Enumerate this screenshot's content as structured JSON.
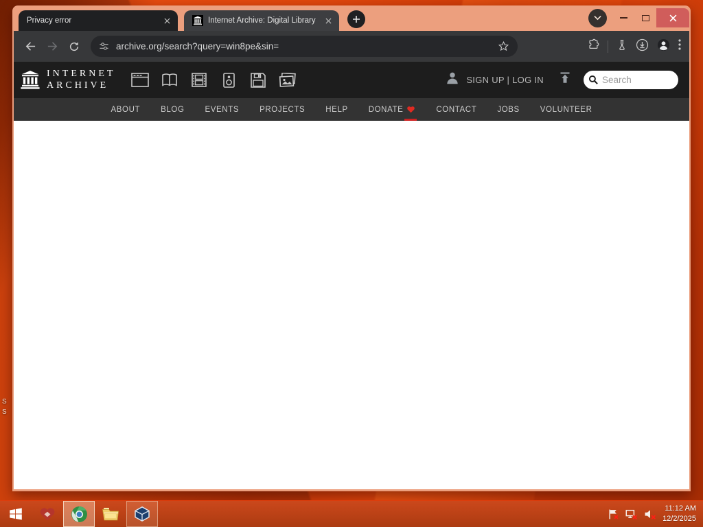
{
  "window": {
    "tabs": [
      {
        "title": "Privacy error",
        "active": false
      },
      {
        "title": "Internet Archive: Digital Library",
        "active": true
      }
    ],
    "url": "archive.org/search?query=win8pe&sin="
  },
  "ia": {
    "brand_line1": "INTERNET",
    "brand_line2": "ARCHIVE",
    "media_types": [
      "web",
      "texts",
      "video",
      "audio",
      "software",
      "images"
    ],
    "auth": "SIGN UP | LOG IN",
    "search_placeholder": "Search",
    "nav": [
      "ABOUT",
      "BLOG",
      "EVENTS",
      "PROJECTS",
      "HELP",
      "DONATE",
      "CONTACT",
      "JOBS",
      "VOLUNTEER"
    ]
  },
  "taskbar": {
    "time": "11:12 AM",
    "date": "12/2/2025"
  },
  "desktop": {
    "fragment1": "S",
    "fragment2": "S"
  },
  "colors": {
    "frame_salmon": "#ec9f7e",
    "desktop_orange": "#d8420b",
    "close_button": "#d05d5b",
    "toolbar_dark": "#37383a",
    "ia_header": "#1d1d1d",
    "ia_nav": "#333333",
    "donate_heart": "#df2b22",
    "donate_underline": "#cf2222"
  }
}
